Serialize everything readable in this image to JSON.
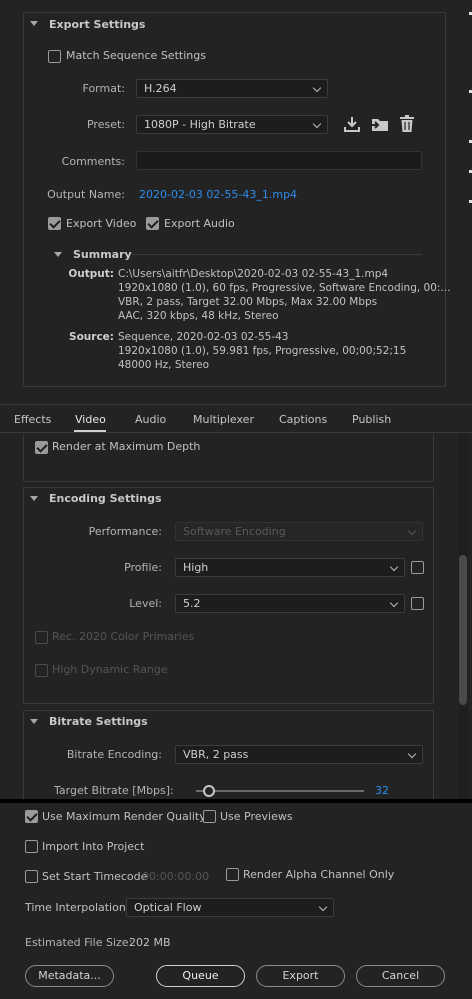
{
  "export_settings": {
    "title": "Export Settings",
    "match_sequence_label": "Match Sequence Settings",
    "format_label": "Format:",
    "format_value": "H.264",
    "preset_label": "Preset:",
    "preset_value": "1080P - High Bitrate",
    "comments_label": "Comments:",
    "comments_value": "",
    "output_name_label": "Output Name:",
    "output_name_value": "2020-02-03 02-55-43_1.mp4",
    "export_video_label": "Export Video",
    "export_audio_label": "Export Audio",
    "export_video_checked": true,
    "export_audio_checked": true,
    "match_sequence_checked": false,
    "icons": [
      "save-preset-icon",
      "import-preset-icon",
      "delete-preset-icon"
    ]
  },
  "summary": {
    "title": "Summary",
    "output_label": "Output:",
    "output_lines": [
      "C:\\Users\\aitfr\\Desktop\\2020-02-03 02-55-43_1.mp4",
      "1920x1080 (1.0), 60 fps, Progressive, Software Encoding, 00:...",
      "VBR, 2 pass, Target 32.00 Mbps, Max 32.00 Mbps",
      "AAC, 320 kbps, 48 kHz, Stereo"
    ],
    "source_label": "Source:",
    "source_lines": [
      "Sequence, 2020-02-03 02-55-43",
      "1920x1080 (1.0), 59.981 fps, Progressive, 00;00;52;15",
      "48000 Hz, Stereo"
    ]
  },
  "tabs": [
    "Effects",
    "Video",
    "Audio",
    "Multiplexer",
    "Captions",
    "Publish"
  ],
  "active_tab": "Video",
  "video": {
    "render_max_depth_label": "Render at Maximum Depth",
    "render_max_depth_checked": true
  },
  "encoding": {
    "title": "Encoding Settings",
    "performance_label": "Performance:",
    "performance_value": "Software Encoding",
    "profile_label": "Profile:",
    "profile_value": "High",
    "level_label": "Level:",
    "level_value": "5.2",
    "rec2020_label": "Rec. 2020 Color Primaries",
    "hdr_label": "High Dynamic Range"
  },
  "bitrate": {
    "title": "Bitrate Settings",
    "encoding_label": "Bitrate Encoding:",
    "encoding_value": "VBR, 2 pass",
    "target_label": "Target Bitrate [Mbps]:",
    "target_value": "32",
    "target_fraction": 0.08
  },
  "bottom": {
    "max_render_quality_label": "Use Maximum Render Quality",
    "max_render_quality_checked": true,
    "use_previews_label": "Use Previews",
    "import_into_project_label": "Import Into Project",
    "set_start_timecode_label": "Set Start Timecode",
    "start_timecode_value": "00:00:00:00",
    "render_alpha_label": "Render Alpha Channel Only",
    "time_interpolation_label": "Time Interpolation:",
    "time_interpolation_value": "Optical Flow",
    "estimated_file_size_label": "Estimated File Size:",
    "estimated_file_size_value": "202 MB",
    "buttons": {
      "metadata": "Metadata...",
      "queue": "Queue",
      "export": "Export",
      "cancel": "Cancel"
    }
  },
  "colors": {
    "background": "#232323",
    "link": "#2d8ceb",
    "divider": "#000000"
  }
}
